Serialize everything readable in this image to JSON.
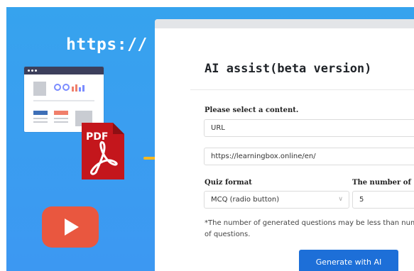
{
  "illustration": {
    "url_text": "https://",
    "pdf_label": "PDF"
  },
  "panel": {
    "title": "AI assist(beta version)",
    "content_label": "Please select a content.",
    "content_type": "URL",
    "url_value": "https://learningbox.online/en/",
    "quiz_format_label": "Quiz format",
    "quiz_format_value": "MCQ (radio button)",
    "number_label": "The number of",
    "number_value": "5",
    "note": "*The number of generated questions may be less than number of questions.",
    "generate_button": "Generate with AI"
  },
  "colors": {
    "background": "#3a9ef0",
    "button": "#1d6fd8",
    "arrow": "#f6b820",
    "pdf": "#c4161c",
    "youtube": "#e9573f"
  }
}
